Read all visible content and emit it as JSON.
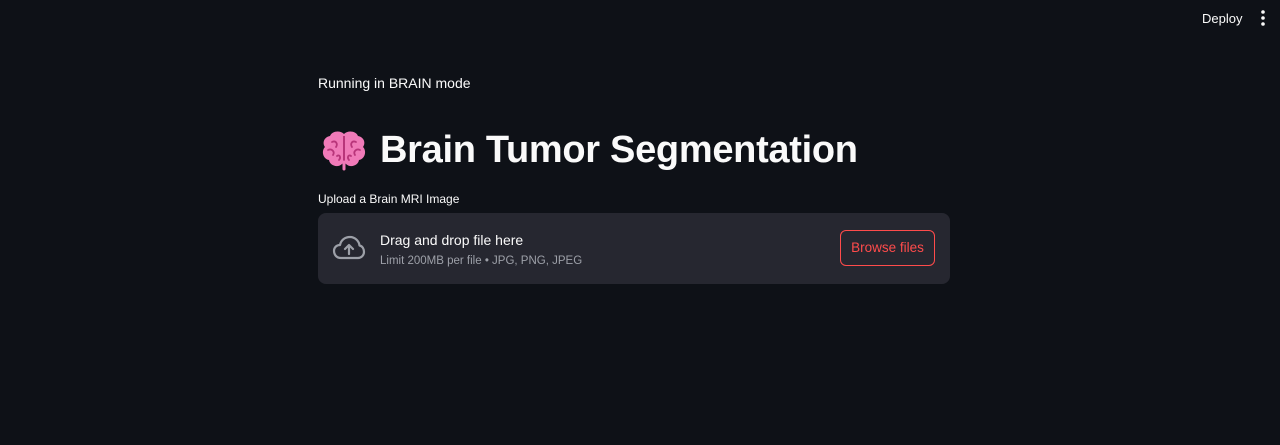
{
  "header": {
    "deploy_label": "Deploy",
    "menu_icon": "kebab-menu-icon"
  },
  "main": {
    "mode_text": "Running in BRAIN mode",
    "title_icon": "brain-icon",
    "title": "Brain Tumor Segmentation",
    "uploader": {
      "label": "Upload a Brain MRI Image",
      "icon": "cloud-upload-icon",
      "drop_title": "Drag and drop file here",
      "drop_subtitle": "Limit 200MB per file • JPG, PNG, JPEG",
      "button_label": "Browse files"
    }
  },
  "colors": {
    "background": "#0e1117",
    "dropzone": "#262730",
    "accent": "#ff4b4b",
    "text": "#fafafa",
    "muted": "#9da0a8"
  }
}
